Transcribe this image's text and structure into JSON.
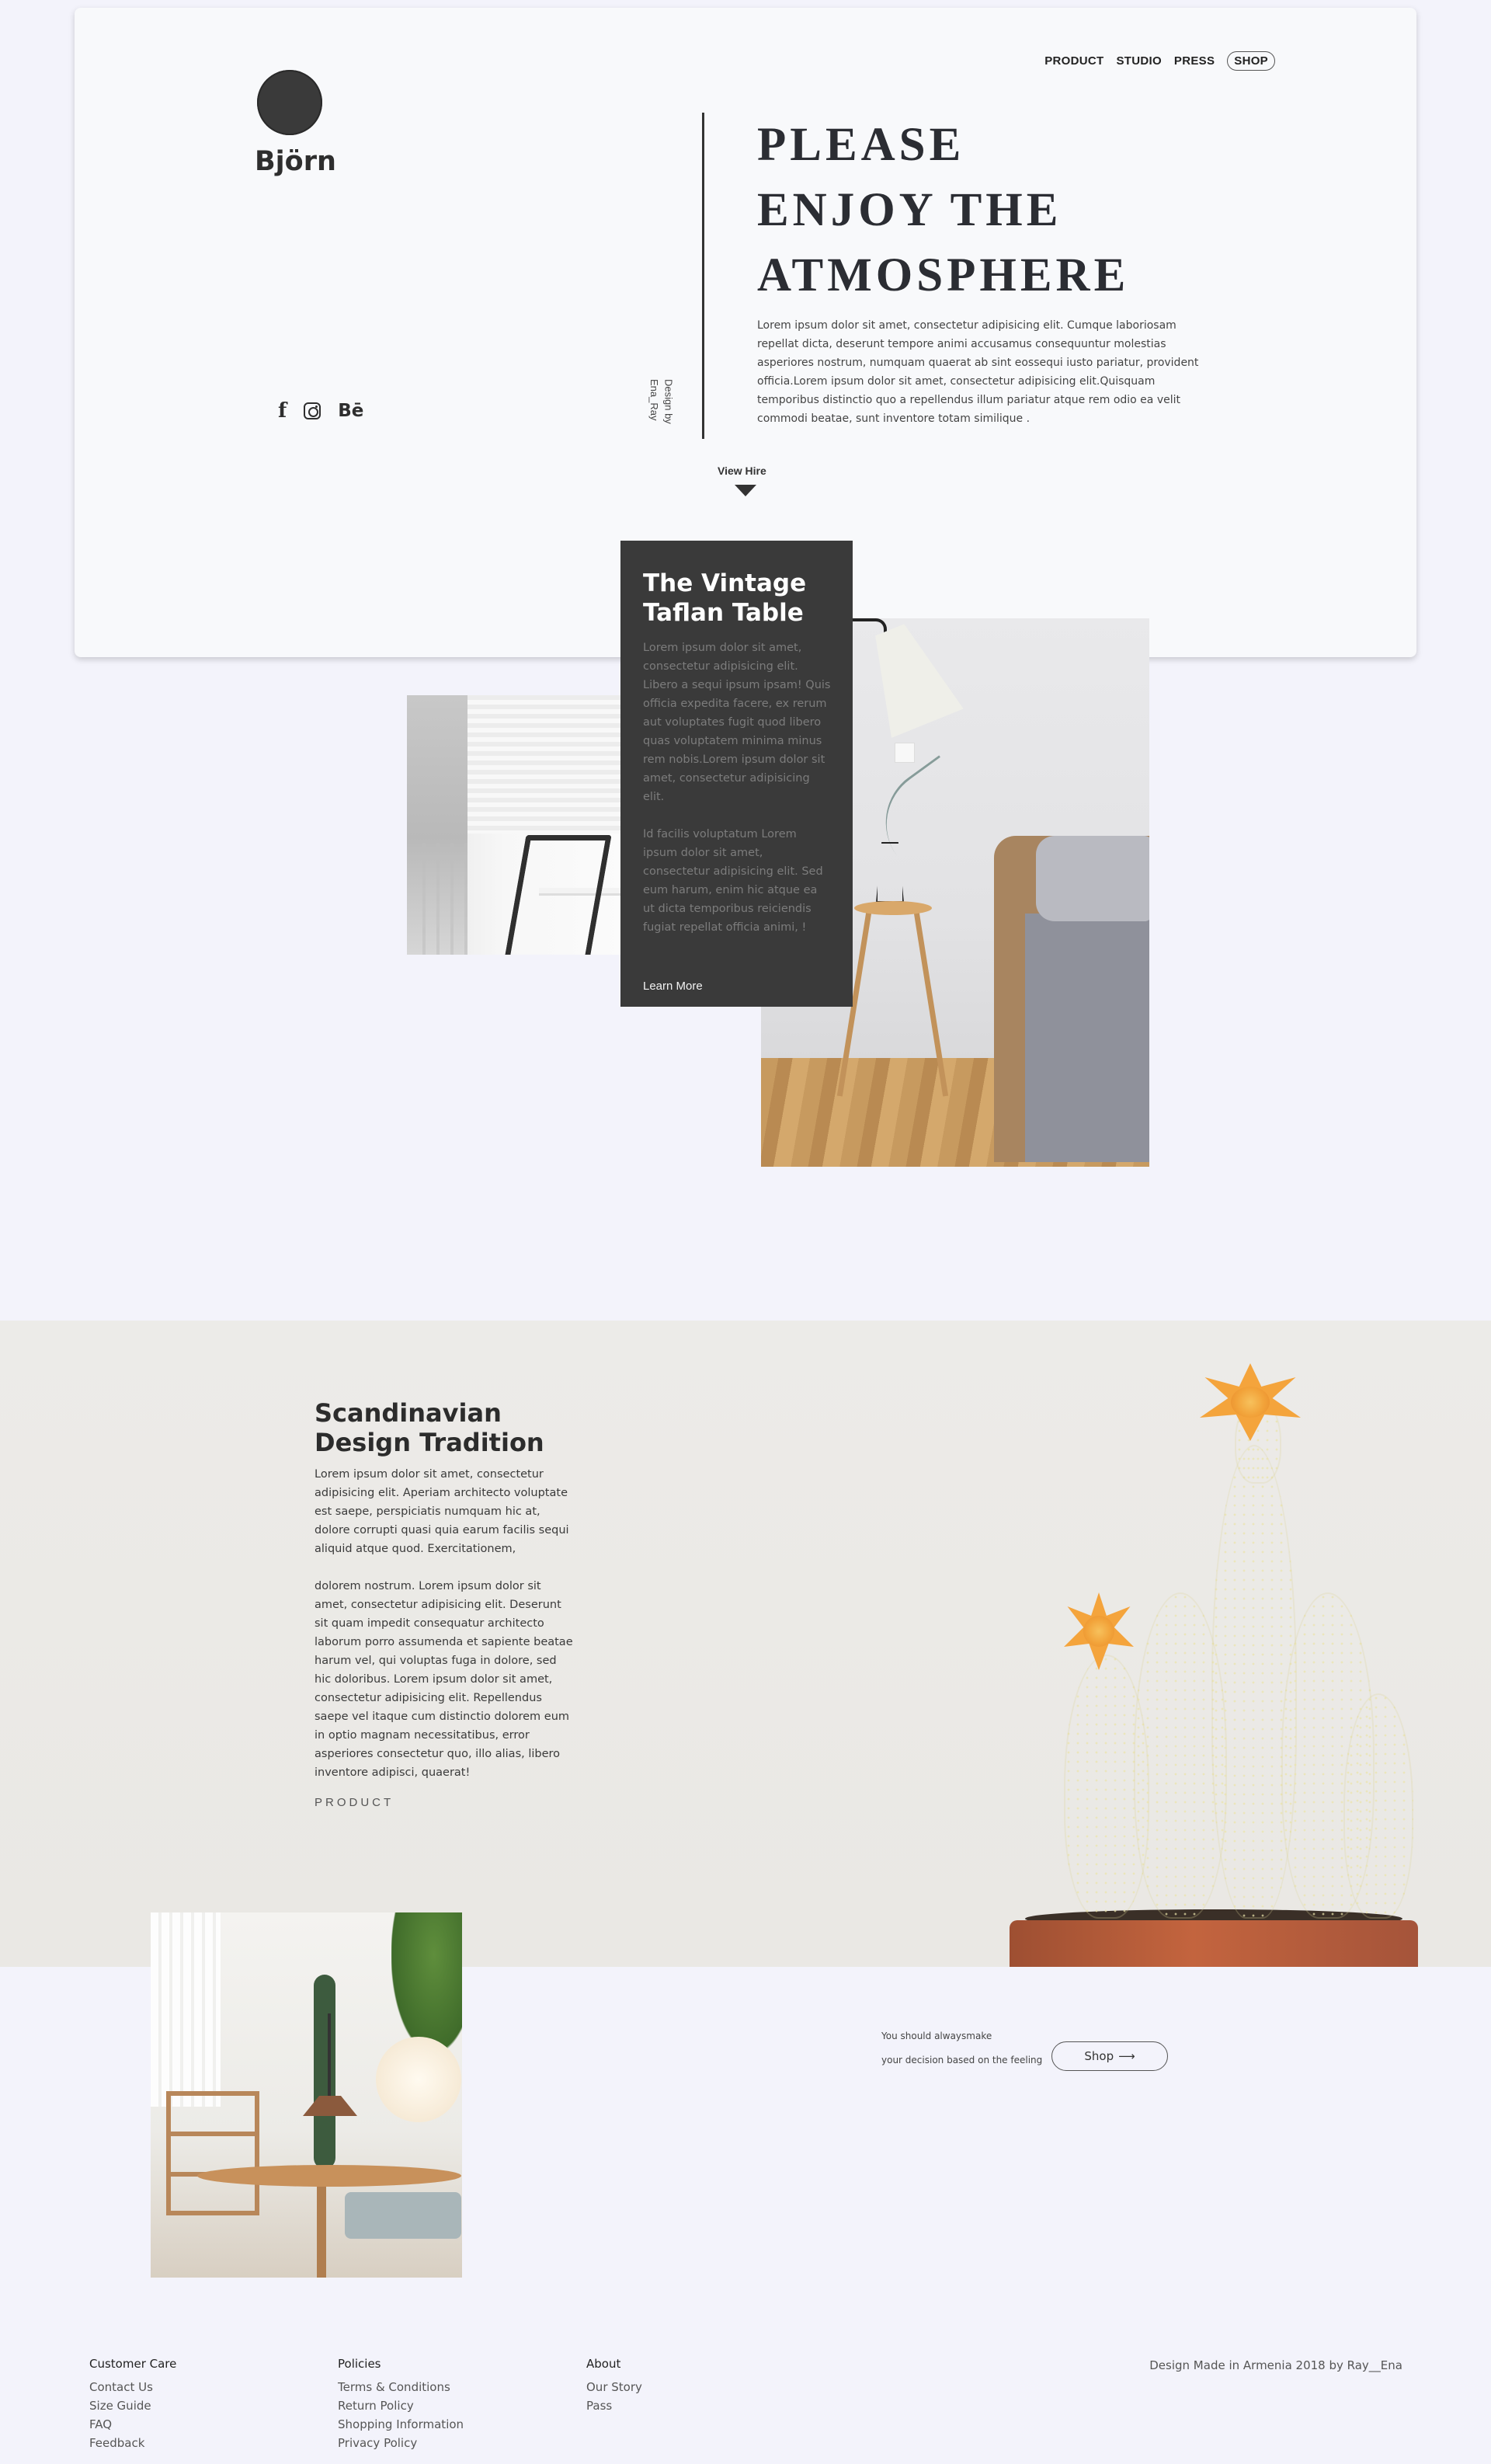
{
  "brand": {
    "name": "Björn"
  },
  "nav": [
    {
      "label": "PRODUCT"
    },
    {
      "label": "STUDIO"
    },
    {
      "label": "PRESS"
    },
    {
      "label": "SHOP"
    }
  ],
  "social": [
    {
      "icon": "facebook-icon",
      "glyph": "f"
    },
    {
      "icon": "instagram-icon",
      "glyph": ""
    },
    {
      "icon": "behance-icon",
      "glyph": "Bē"
    }
  ],
  "credit": {
    "line1": "Design by",
    "line2": "Ena_Ray"
  },
  "hero": {
    "title_lines": [
      "PLEASE",
      "ENJOY THE",
      "ATMOSPHERE"
    ],
    "body": "Lorem ipsum dolor sit amet, consectetur adipisicing elit. Cumque laboriosam repellat dicta, deserunt tempore animi accusamus consequuntur molestias asperiores nostrum, numquam quaerat ab sint eossequi iusto pariatur, provident officia.Lorem ipsum dolor sit amet, consectetur adipisicing elit.Quisquam temporibus distinctio quo a repellendus illum pariatur atque rem odio ea velit commodi beatae, sunt inventore totam similique ."
  },
  "view_hire": {
    "label": "View Hire"
  },
  "product_card": {
    "title": "The Vintage Taflan Table",
    "body1": "Lorem ipsum dolor sit amet, consectetur adipisicing elit. Libero a sequi ipsum ipsam! Quis officia expedita facere, ex rerum aut voluptates fugit quod libero quas voluptatem minima minus rem nobis.Lorem ipsum dolor sit amet, consectetur adipisicing elit.",
    "body2": "Id facilis voluptatum Lorem ipsum dolor sit amet, consectetur adipisicing elit. Sed eum harum, enim hic atque ea ut dicta temporibus reiciendis fugiat repellat officia animi, !",
    "link": "Learn More"
  },
  "scandi": {
    "title_line1": "Scandinavian",
    "title_line2": "Design Tradition",
    "body1": "Lorem ipsum dolor sit amet, consectetur adipisicing elit. Aperiam architecto voluptate est saepe, perspiciatis numquam hic at, dolore corrupti quasi quia earum facilis sequi aliquid atque quod. Exercitationem,",
    "body2": "dolorem nostrum. Lorem ipsum dolor sit amet, consectetur adipisicing elit. Deserunt sit quam impedit consequatur architecto laborum porro assumenda et sapiente beatae harum vel, qui voluptas fuga in dolore, sed hic doloribus. Lorem ipsum dolor sit amet, consectetur adipisicing elit. Repellendus saepe vel itaque cum distinctio dolorem eum in optio magnam necessitatibus, error asperiores consectetur quo, illo alias, libero inventore adipisci, quaerat!",
    "link": "PRODUCT"
  },
  "cta": {
    "line1": "You should alwaysmake",
    "line2": "your decision based on the feeling",
    "button": "Shop",
    "arrow": "⟶"
  },
  "footer": {
    "columns": [
      {
        "heading": "Customer Care",
        "links": [
          "Contact Us",
          "Size Guide",
          "FAQ",
          "Feedback"
        ]
      },
      {
        "heading": "Policies",
        "links": [
          "Terms & Conditions",
          "Return Policy",
          "Shopping Information",
          "Privacy Policy"
        ]
      },
      {
        "heading": "About",
        "links": [
          "Our Story",
          "Pass"
        ]
      }
    ],
    "credit": "Design Made in Armenia 2018 by Ray__Ena"
  }
}
